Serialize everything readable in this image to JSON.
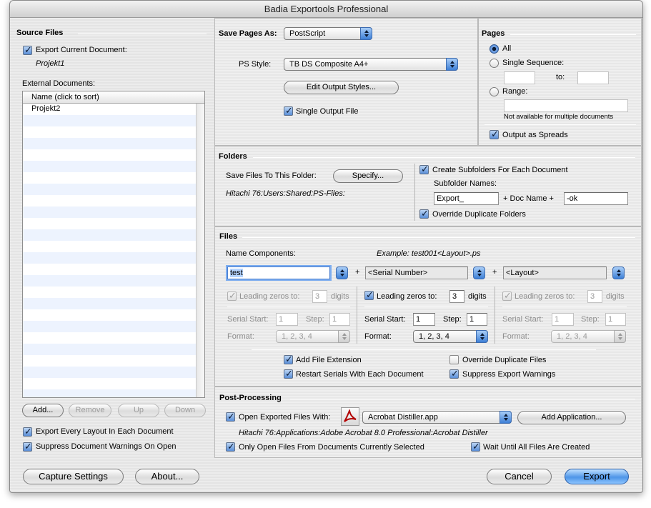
{
  "window": {
    "title": "Badia Exportools Professional"
  },
  "source": {
    "header": "Source Files",
    "export_current_label": "Export Current Document:",
    "current_doc": "Projekt1",
    "external_label": "External Documents:",
    "list_header": "Name (click to sort)",
    "list_items": [
      "Projekt2"
    ],
    "add_button": "Add...",
    "remove_button": "Remove",
    "up_button": "Up",
    "down_button": "Down",
    "export_every_layout": "Export Every Layout In Each Document",
    "suppress_doc_warnings": "Suppress Document Warnings On Open"
  },
  "save": {
    "label": "Save Pages As:",
    "format": "PostScript",
    "ps_style_label": "PS Style:",
    "ps_style": "TB DS Composite A4+",
    "edit_styles_button": "Edit Output Styles...",
    "single_output_label": "Single Output File"
  },
  "pages": {
    "header": "Pages",
    "all_label": "All",
    "single_sequence_label": "Single Sequence:",
    "to_label": "to:",
    "from_value": "",
    "to_value": "",
    "range_label": "Range:",
    "range_value": "",
    "note": "Not available for multiple documents",
    "spreads_label": "Output as Spreads"
  },
  "folders": {
    "header": "Folders",
    "save_label": "Save Files To This Folder:",
    "specify_button": "Specify...",
    "path": "Hitachi 76:Users:Shared:PS-Files:",
    "create_subfolders_label": "Create Subfolders For Each Document",
    "subfolder_names_label": "Subfolder Names:",
    "prefix": "Export_",
    "plus_doc_name": "+ Doc Name +",
    "suffix": "-ok",
    "override_folders_label": "Override Duplicate Folders"
  },
  "files": {
    "header": "Files",
    "name_components_label": "Name Components:",
    "example": "Example: test001<Layout>.ps",
    "plus": "+",
    "component1": "test",
    "component2": "<Serial Number>",
    "component3": "<Layout>",
    "leading_zeros_label": "Leading zeros to:",
    "digits_label": "digits",
    "serial_start_label": "Serial Start:",
    "step_label": "Step:",
    "format_label": "Format:",
    "columns": [
      {
        "zeros": "3",
        "start": "1",
        "step": "1",
        "format": "1, 2, 3, 4"
      },
      {
        "zeros": "3",
        "start": "1",
        "step": "1",
        "format": "1, 2, 3, 4"
      },
      {
        "zeros": "3",
        "start": "1",
        "step": "1",
        "format": "1, 2, 3, 4"
      }
    ],
    "add_extension_label": "Add File Extension",
    "override_files_label": "Override Duplicate Files",
    "restart_serials_label": "Restart Serials With Each Document",
    "suppress_warnings_label": "Suppress Export Warnings"
  },
  "post": {
    "header": "Post-Processing",
    "open_with_label": "Open Exported Files With:",
    "application": "Acrobat Distiller.app",
    "add_app_button": "Add Application...",
    "app_path": "Hitachi 76:Applications:Adobe Acrobat 8.0 Professional:Acrobat Distiller",
    "only_open_label": "Only Open Files From Documents Currently Selected",
    "wait_label": "Wait Until All Files Are Created"
  },
  "footer": {
    "capture_button": "Capture Settings",
    "about_button": "About...",
    "cancel_button": "Cancel",
    "export_button": "Export"
  }
}
